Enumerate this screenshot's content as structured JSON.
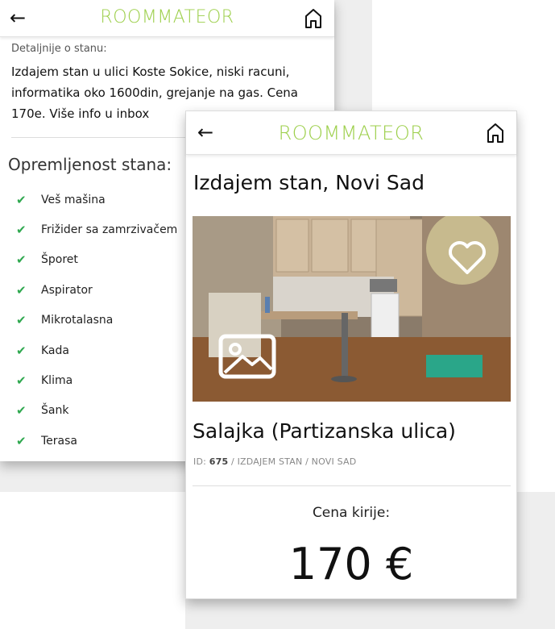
{
  "app": {
    "logo": "ROOMMATEOR"
  },
  "back_screen": {
    "details_label": "Detaljnije o stanu:",
    "details_text": "Izdajem stan u ulici Koste Sokice, niski racuni, informatika oko 1600din, grejanje na gas. Cena 170e. Više info u inbox",
    "equipment_title": "Opremljenost stana:",
    "amenities": [
      "Veš mašina",
      "Frižider sa zamrzivačem",
      "Šporet",
      "Aspirator",
      "Mikrotalasna",
      "Kada",
      "Klima",
      "Šank",
      "Terasa"
    ]
  },
  "front_screen": {
    "listing_title": "Izdajem stan, Novi Sad",
    "location": "Salajka (Partizanska ulica)",
    "meta": {
      "id_label": "ID:",
      "id_value": "675",
      "path": "/ IZDAJEM STAN / NOVI SAD"
    },
    "price_label": "Cena kirije:",
    "price": "170 €"
  },
  "icons": {
    "back": "arrow-left-icon",
    "home": "home-icon",
    "favorite": "heart-icon",
    "gallery": "image-icon",
    "check": "check-icon"
  },
  "colors": {
    "brand": "#9ccf4a",
    "check": "#2fa84f"
  }
}
